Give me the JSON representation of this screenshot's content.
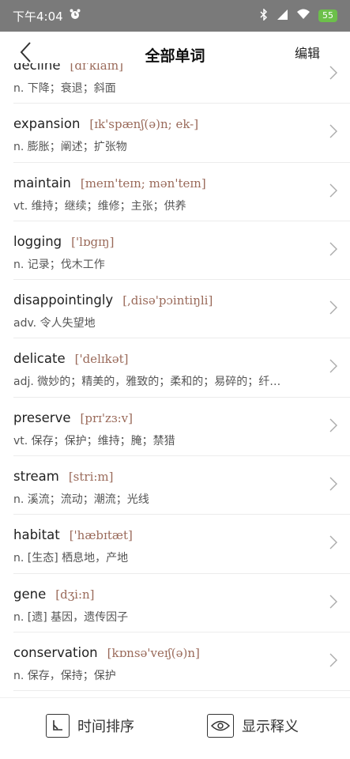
{
  "status_bar": {
    "time": "下午4:04",
    "battery": "55",
    "alarm_icon": "alarm-clock-icon",
    "bluetooth_icon": "bluetooth-icon",
    "signal_icon": "signal-icon",
    "wifi_icon": "wifi-icon"
  },
  "nav": {
    "back_icon": "chevron-left-icon",
    "title": "全部单词",
    "edit_label": "编辑"
  },
  "words": [
    {
      "word": "decline",
      "phonetic": "[dɪ'klaɪn]",
      "definition": "n. 下降；衰退；斜面"
    },
    {
      "word": "expansion",
      "phonetic": "[ɪk'spænʃ(ə)n; ek-]",
      "definition": "n. 膨胀；阐述；扩张物"
    },
    {
      "word": "maintain",
      "phonetic": "[meɪn'teɪn; mən'teɪn]",
      "definition": "vt. 维持；继续；维修；主张；供养"
    },
    {
      "word": "logging",
      "phonetic": "['lɒgɪŋ]",
      "definition": "n. 记录；伐木工作"
    },
    {
      "word": "disappointingly",
      "phonetic": "[,disə'pɔintiŋli]",
      "definition": "adv. 令人失望地"
    },
    {
      "word": "delicate",
      "phonetic": "['delɪkət]",
      "definition": "adj. 微妙的；精美的，雅致的；柔和的；易碎的；纤…"
    },
    {
      "word": "preserve",
      "phonetic": "[prɪ'zɜ:v]",
      "definition": "vt. 保存；保护；维持；腌；禁猎"
    },
    {
      "word": "stream",
      "phonetic": "[stri:m]",
      "definition": "n. 溪流；流动；潮流；光线"
    },
    {
      "word": "habitat",
      "phonetic": "['hæbɪtæt]",
      "definition": "n. [生态] 栖息地，产地"
    },
    {
      "word": "gene",
      "phonetic": "[dʒi:n]",
      "definition": "n. [遗] 基因，遗传因子"
    },
    {
      "word": "conservation",
      "phonetic": "[kɒnsə'veɪʃ(ə)n]",
      "definition": "n. 保存，保持；保护"
    }
  ],
  "bottom": {
    "sort_label": "时间排序",
    "sort_icon": "clock-icon",
    "show_label": "显示释义",
    "show_icon": "eye-icon"
  }
}
